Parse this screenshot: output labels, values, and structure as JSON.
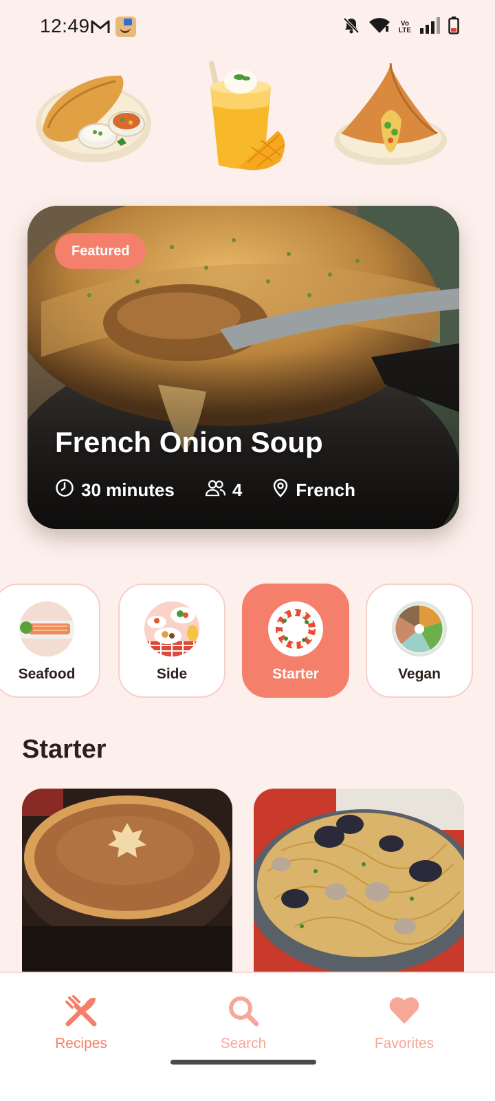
{
  "status_bar": {
    "time": "12:49",
    "icons": [
      "gmail-icon",
      "amazon-app-icon",
      "bell-off-icon",
      "wifi-icon",
      "volte-icon",
      "signal-icon",
      "battery-icon"
    ],
    "volte_line1": "Vo",
    "volte_line2": "LTE"
  },
  "hero_images": [
    "dosa-plate",
    "mango-lassi",
    "samosa-plate"
  ],
  "featured": {
    "badge": "Featured",
    "title": "French Onion Soup",
    "time": "30 minutes",
    "servings": "4",
    "cuisine": "French"
  },
  "categories": [
    {
      "label": "Seafood",
      "active": false
    },
    {
      "label": "Side",
      "active": false
    },
    {
      "label": "Starter",
      "active": true
    },
    {
      "label": "Vegan",
      "active": false
    }
  ],
  "section": {
    "title": "Starter"
  },
  "recipes": [
    "maple-pie",
    "seafood-pasta"
  ],
  "nav": {
    "recipes": "Recipes",
    "search": "Search",
    "favorites": "Favorites"
  },
  "colors": {
    "accent": "#f4806b",
    "background": "#fdf0ec",
    "text": "#2b1f1c"
  }
}
